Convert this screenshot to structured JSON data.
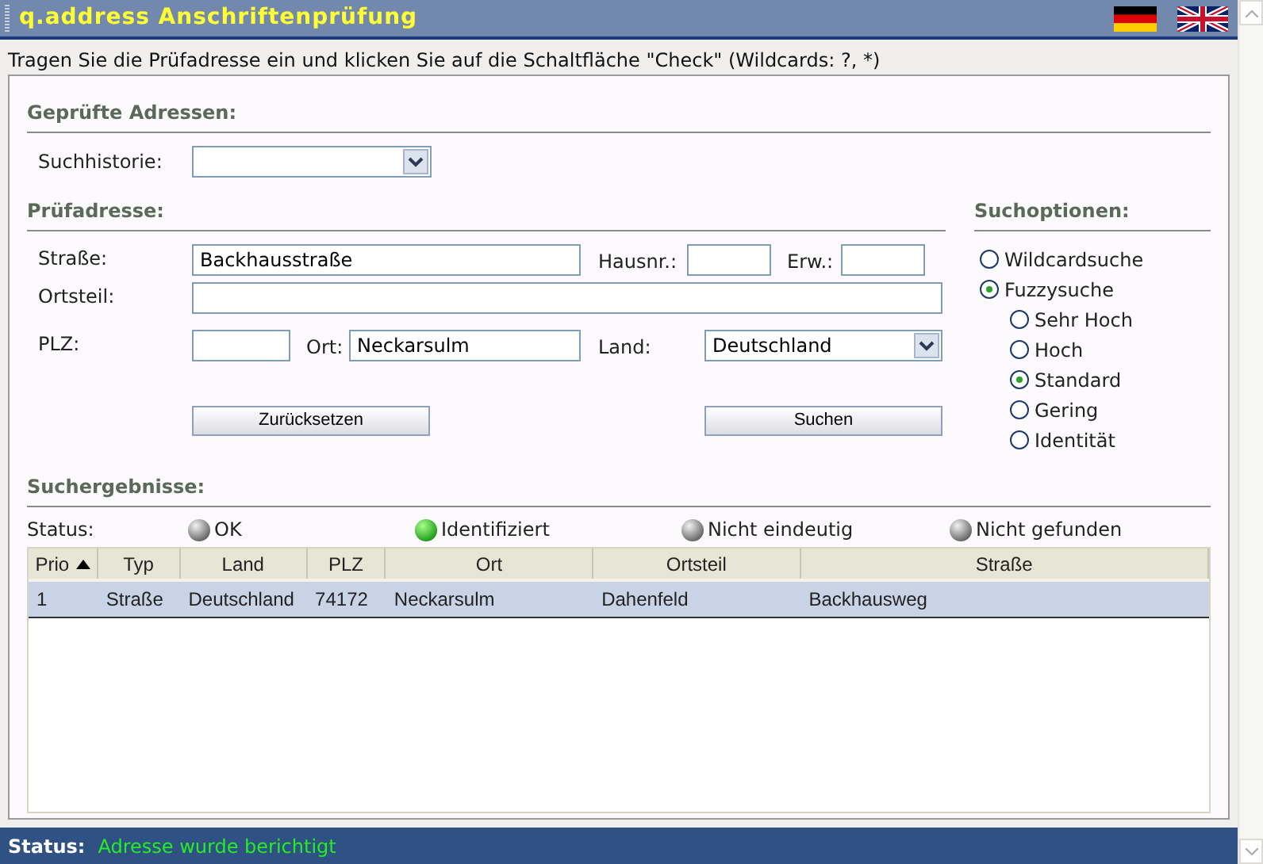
{
  "window": {
    "title": "q.address Anschriftenprüfung"
  },
  "instructions": "Tragen Sie die Prüfadresse ein und klicken Sie auf die Schaltfläche \"Check\" (Wildcards: ?, *)",
  "checked_addresses": {
    "heading": "Geprüfte Adressen:",
    "history_label": "Suchhistorie:"
  },
  "address": {
    "heading": "Prüfadresse:",
    "street": {
      "label": "Straße:",
      "value": "Backhausstraße"
    },
    "house_number": {
      "label": "Hausnr.:"
    },
    "extension": {
      "label": "Erw.:"
    },
    "district": {
      "label": "Ortsteil:"
    },
    "postcode": {
      "label": "PLZ:"
    },
    "city": {
      "label": "Ort:",
      "value": "Neckarsulm"
    },
    "country": {
      "label": "Land:",
      "value": "Deutschland"
    },
    "buttons": [
      "Zurücksetzen",
      "Suchen"
    ]
  },
  "search_options": {
    "heading": "Suchoptionen:",
    "options": [
      {
        "label": "Wildcardsuche",
        "selected": false
      },
      {
        "label": "Fuzzysuche",
        "selected": true,
        "children": [
          {
            "label": "Sehr Hoch",
            "selected": false
          },
          {
            "label": "Hoch",
            "selected": false
          },
          {
            "label": "Standard",
            "selected": true
          },
          {
            "label": "Gering",
            "selected": false
          },
          {
            "label": "Identität",
            "selected": false
          }
        ]
      }
    ]
  },
  "results": {
    "heading": "Suchergebnisse:",
    "status_label": "Status:",
    "legend": [
      {
        "label": "OK",
        "lit": false
      },
      {
        "label": "Identifiziert",
        "lit": true
      },
      {
        "label": "Nicht eindeutig",
        "lit": false
      },
      {
        "label": "Nicht gefunden",
        "lit": false
      }
    ],
    "table": {
      "columns": [
        {
          "label": "Prio",
          "sorted": true
        },
        {
          "label": "Typ",
          "sorted": false
        },
        {
          "label": "Land",
          "sorted": false
        },
        {
          "label": "PLZ",
          "sorted": false
        },
        {
          "label": "Ort",
          "sorted": false
        },
        {
          "label": "Ortsteil",
          "sorted": false
        },
        {
          "label": "Straße",
          "sorted": false
        }
      ],
      "rows": [
        {
          "selected": true,
          "cells": [
            "1",
            "Straße",
            "Deutschland",
            "74172",
            "Neckarsulm",
            "Dahenfeld",
            "Backhausweg"
          ]
        }
      ]
    }
  },
  "status_bar": {
    "label": "Status:",
    "message": "Adresse wurde berichtigt"
  }
}
